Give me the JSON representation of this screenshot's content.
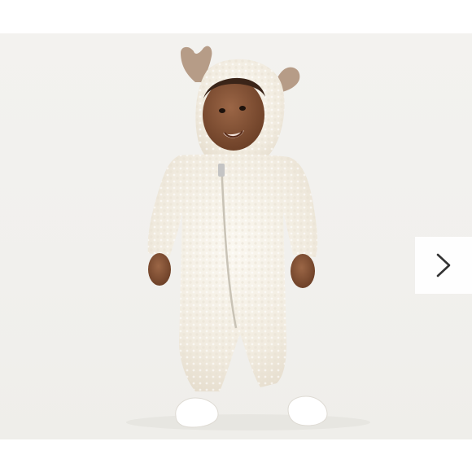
{
  "gallery": {
    "image_description_hidden": "",
    "next_button": {
      "icon": "chevron-right-icon"
    }
  },
  "colors": {
    "background": "#ffffff",
    "photo_backdrop": "#f2f1ee",
    "fleece": "#f4f0e6",
    "antler": "#b69c87",
    "skin": "#8a5a3c",
    "chevron": "#333333"
  }
}
